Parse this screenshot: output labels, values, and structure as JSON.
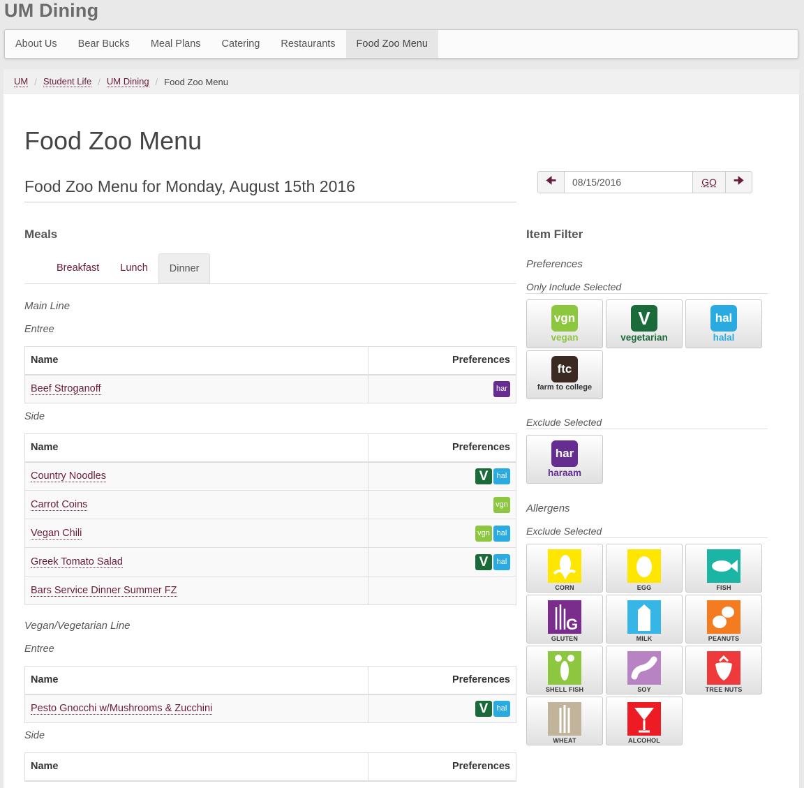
{
  "site": {
    "title": "UM Dining"
  },
  "nav": {
    "items": [
      "About Us",
      "Bear Bucks",
      "Meal Plans",
      "Catering",
      "Restaurants",
      "Food Zoo Menu"
    ],
    "active_index": 5
  },
  "breadcrumb": [
    "UM",
    "Student Life",
    "UM Dining",
    "Food Zoo Menu"
  ],
  "page": {
    "title": "Food Zoo Menu",
    "menu_heading": "Food Zoo Menu for Monday, August 15th 2016"
  },
  "date_picker": {
    "value": "08/15/2016",
    "go_label": "GO"
  },
  "meals": {
    "label": "Meals",
    "tabs": [
      "Breakfast",
      "Lunch",
      "Dinner"
    ],
    "active_tab": "Dinner",
    "table_headers": {
      "name": "Name",
      "preferences": "Preferences"
    },
    "lines": [
      {
        "line": "Main Line",
        "sections": [
          {
            "section": "Entree",
            "items": [
              {
                "name": "Beef Stroganoff",
                "prefs": [
                  "har"
                ]
              }
            ]
          },
          {
            "section": "Side",
            "items": [
              {
                "name": "Country Noodles",
                "prefs": [
                  "V",
                  "hal"
                ]
              },
              {
                "name": "Carrot Coins",
                "prefs": [
                  "vgn"
                ]
              },
              {
                "name": "Vegan Chili",
                "prefs": [
                  "vgn",
                  "hal"
                ]
              },
              {
                "name": "Greek Tomato Salad",
                "prefs": [
                  "V",
                  "hal"
                ]
              },
              {
                "name": "Bars Service Dinner Summer FZ",
                "prefs": []
              }
            ]
          }
        ]
      },
      {
        "line": "Vegan/Vegetarian Line",
        "sections": [
          {
            "section": "Entree",
            "items": [
              {
                "name": "Pesto Gnocchi w/Mushrooms & Zucchini",
                "prefs": [
                  "V",
                  "hal"
                ]
              }
            ]
          },
          {
            "section": "Side",
            "items": []
          }
        ]
      }
    ]
  },
  "filter": {
    "label": "Item Filter",
    "preferences_label": "Preferences",
    "only_include_label": "Only Include Selected",
    "exclude_label": "Exclude Selected",
    "allergens_label": "Allergens",
    "allergen_exclude_label": "Exclude Selected",
    "include_buttons": [
      {
        "icon": "vgn",
        "label": "vegan",
        "color": "#8dc63f"
      },
      {
        "icon": "V",
        "label": "vegetarian",
        "color": "#1b6b3a"
      },
      {
        "icon": "hal",
        "label": "halal",
        "color": "#29abe2"
      },
      {
        "icon": "ftc",
        "label": "farm to college",
        "color": "#3a2a22"
      }
    ],
    "exclude_buttons": [
      {
        "icon": "har",
        "label": "haraam",
        "color": "#662d91"
      }
    ],
    "allergens": [
      {
        "label": "CORN",
        "icon": "corn-icon",
        "color": "#ffe600"
      },
      {
        "label": "EGG",
        "icon": "egg-icon",
        "color": "#ffe600"
      },
      {
        "label": "FISH",
        "icon": "fish-icon",
        "color": "#1bb5a6"
      },
      {
        "label": "GLUTEN",
        "icon": "gluten-icon",
        "color": "#7b2d8e"
      },
      {
        "label": "MILK",
        "icon": "milk-icon",
        "color": "#35b6e6"
      },
      {
        "label": "PEANUTS",
        "icon": "peanut-icon",
        "color": "#f47b20"
      },
      {
        "label": "SHELL FISH",
        "icon": "lobster-icon",
        "color": "#8dc63f"
      },
      {
        "label": "SOY",
        "icon": "soy-icon",
        "color": "#b783c2"
      },
      {
        "label": "TREE NUTS",
        "icon": "strawberry-icon",
        "color": "#ee3a3a"
      },
      {
        "label": "WHEAT",
        "icon": "wheat-icon",
        "color": "#c2b49a"
      },
      {
        "label": "ALCOHOL",
        "icon": "cocktail-icon",
        "color": "#ed1c24"
      }
    ]
  },
  "badge_colors": {
    "har": "#662d91",
    "V": "#1b6b3a",
    "hal": "#29abe2",
    "vgn": "#8dc63f"
  }
}
